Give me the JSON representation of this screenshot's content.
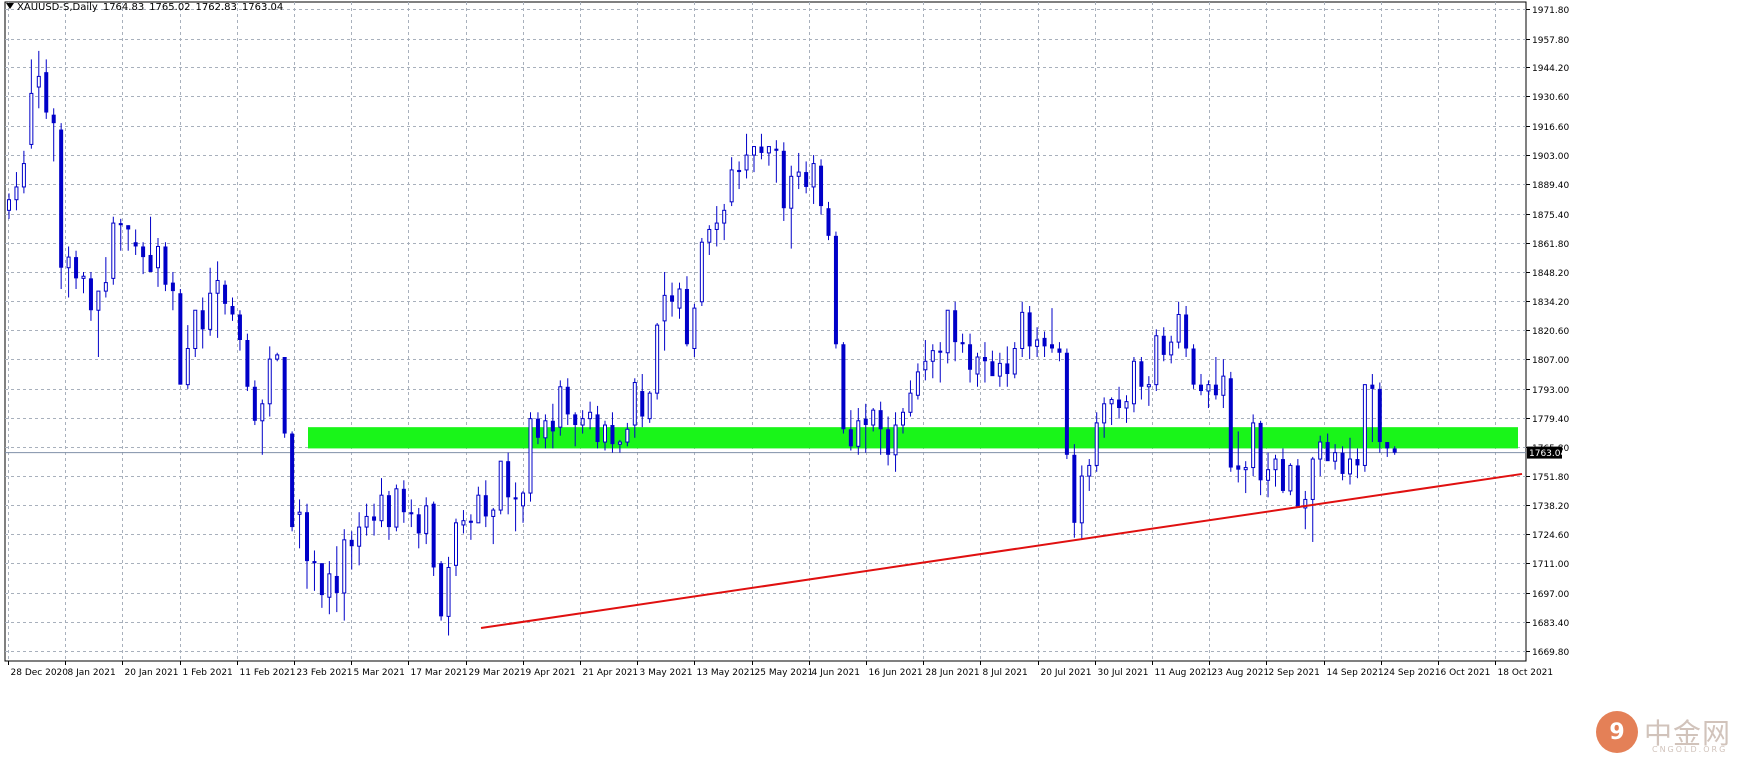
{
  "header": {
    "symbol": "XAUUSD-S,Daily",
    "open": "1764.83",
    "high": "1765.02",
    "low": "1762.83",
    "close": "1763.04"
  },
  "current_price_label": "1763.04",
  "watermark": {
    "badge": "9",
    "name": "中金网",
    "domain": "CNGOLD.ORG"
  },
  "colors": {
    "candle": "#0000c8",
    "grid": "#a8b0bc",
    "zone": "#19f519",
    "trendline": "#e01010",
    "price_line": "#8090a8",
    "axis": "#000000"
  },
  "chart_data": {
    "type": "candlestick",
    "title": "XAUUSD-S,Daily",
    "ylim": [
      1665,
      1975
    ],
    "y_ticks": [
      "1971.80",
      "1957.80",
      "1944.20",
      "1930.60",
      "1916.60",
      "1903.00",
      "1889.40",
      "1875.40",
      "1861.80",
      "1848.20",
      "1834.20",
      "1820.60",
      "1807.00",
      "1793.00",
      "1779.40",
      "1765.80",
      "1751.80",
      "1738.20",
      "1724.60",
      "1711.00",
      "1697.00",
      "1683.40",
      "1669.80"
    ],
    "x_ticks": [
      "28 Dec 2020",
      "8 Jan 2021",
      "20 Jan 2021",
      "1 Feb 2021",
      "11 Feb 2021",
      "23 Feb 2021",
      "5 Mar 2021",
      "17 Mar 2021",
      "29 Mar 2021",
      "9 Apr 2021",
      "21 Apr 2021",
      "3 May 2021",
      "13 May 2021",
      "25 May 2021",
      "4 Jun 2021",
      "16 Jun 2021",
      "28 Jun 2021",
      "8 Jul 2021",
      "20 Jul 2021",
      "30 Jul 2021",
      "11 Aug 2021",
      "23 Aug 2021",
      "2 Sep 2021",
      "14 Sep 2021",
      "24 Sep 2021",
      "6 Oct 2021",
      "18 Oct 2021"
    ],
    "x_start": "2020-12-28",
    "candles": [
      [
        1877,
        1885,
        1873,
        1882
      ],
      [
        1882,
        1895,
        1877,
        1888
      ],
      [
        1888,
        1905,
        1885,
        1899
      ],
      [
        1908,
        1948,
        1906,
        1932
      ],
      [
        1935,
        1952,
        1925,
        1940
      ],
      [
        1942,
        1948,
        1920,
        1923
      ],
      [
        1922,
        1925,
        1900,
        1918
      ],
      [
        1915,
        1918,
        1840,
        1850
      ],
      [
        1850,
        1860,
        1836,
        1855
      ],
      [
        1855,
        1858,
        1840,
        1845
      ],
      [
        1845,
        1848,
        1838,
        1846
      ],
      [
        1845,
        1848,
        1825,
        1830
      ],
      [
        1830,
        1839,
        1808,
        1839
      ],
      [
        1839,
        1855,
        1836,
        1843
      ],
      [
        1845,
        1874,
        1842,
        1871
      ],
      [
        1871,
        1873,
        1858,
        1870
      ],
      [
        1870,
        1870,
        1858,
        1868
      ],
      [
        1862,
        1868,
        1856,
        1860
      ],
      [
        1860,
        1862,
        1847,
        1855
      ],
      [
        1856,
        1874,
        1849,
        1848
      ],
      [
        1850,
        1864,
        1841,
        1860
      ],
      [
        1860,
        1862,
        1839,
        1842
      ],
      [
        1843,
        1848,
        1830,
        1839
      ],
      [
        1838,
        1840,
        1795,
        1795
      ],
      [
        1795,
        1823,
        1793,
        1812
      ],
      [
        1812,
        1830,
        1808,
        1830
      ],
      [
        1830,
        1836,
        1812,
        1821
      ],
      [
        1821,
        1850,
        1818,
        1838
      ],
      [
        1838,
        1853,
        1817,
        1844
      ],
      [
        1842,
        1844,
        1828,
        1833
      ],
      [
        1832,
        1836,
        1825,
        1828
      ],
      [
        1828,
        1830,
        1811,
        1816
      ],
      [
        1816,
        1819,
        1792,
        1794
      ],
      [
        1794,
        1797,
        1776,
        1778
      ],
      [
        1778,
        1788,
        1762,
        1786
      ],
      [
        1786,
        1813,
        1780,
        1807
      ],
      [
        1807,
        1810,
        1806,
        1809
      ],
      [
        1808,
        1808,
        1770,
        1772
      ],
      [
        1772,
        1773,
        1726,
        1728
      ],
      [
        1734,
        1741,
        1718,
        1735
      ],
      [
        1735,
        1739,
        1699,
        1712
      ],
      [
        1712,
        1717,
        1698,
        1711
      ],
      [
        1711,
        1711,
        1690,
        1696
      ],
      [
        1695,
        1712,
        1687,
        1706
      ],
      [
        1705,
        1719,
        1688,
        1697
      ],
      [
        1697,
        1727,
        1684,
        1722
      ],
      [
        1722,
        1726,
        1708,
        1719
      ],
      [
        1719,
        1735,
        1710,
        1728
      ],
      [
        1728,
        1739,
        1724,
        1733
      ],
      [
        1733,
        1739,
        1724,
        1731
      ],
      [
        1731,
        1751,
        1728,
        1743
      ],
      [
        1743,
        1745,
        1722,
        1728
      ],
      [
        1728,
        1748,
        1726,
        1746
      ],
      [
        1746,
        1750,
        1730,
        1735
      ],
      [
        1735,
        1741,
        1728,
        1734
      ],
      [
        1734,
        1737,
        1718,
        1725
      ],
      [
        1725,
        1742,
        1720,
        1738
      ],
      [
        1739,
        1740,
        1705,
        1709
      ],
      [
        1711,
        1712,
        1684,
        1686
      ],
      [
        1686,
        1714,
        1677,
        1709
      ],
      [
        1710,
        1732,
        1705,
        1730
      ],
      [
        1729,
        1736,
        1725,
        1731
      ],
      [
        1731,
        1734,
        1722,
        1730
      ],
      [
        1730,
        1747,
        1730,
        1743
      ],
      [
        1743,
        1750,
        1728,
        1733
      ],
      [
        1733,
        1737,
        1720,
        1736
      ],
      [
        1736,
        1759,
        1734,
        1759
      ],
      [
        1759,
        1763,
        1734,
        1742
      ],
      [
        1742,
        1749,
        1726,
        1741
      ],
      [
        1738,
        1745,
        1730,
        1744
      ],
      [
        1744,
        1782,
        1740,
        1779
      ],
      [
        1779,
        1782,
        1767,
        1770
      ],
      [
        1770,
        1781,
        1765,
        1778
      ],
      [
        1778,
        1786,
        1765,
        1773
      ],
      [
        1775,
        1797,
        1771,
        1794
      ],
      [
        1794,
        1798,
        1776,
        1781
      ],
      [
        1781,
        1782,
        1766,
        1776
      ],
      [
        1776,
        1783,
        1772,
        1779
      ],
      [
        1779,
        1787,
        1774,
        1782
      ],
      [
        1781,
        1785,
        1765,
        1768
      ],
      [
        1768,
        1778,
        1764,
        1776
      ],
      [
        1776,
        1782,
        1763,
        1767
      ],
      [
        1767,
        1769,
        1763,
        1768
      ],
      [
        1768,
        1777,
        1766,
        1774
      ],
      [
        1776,
        1798,
        1770,
        1796
      ],
      [
        1792,
        1800,
        1775,
        1780
      ],
      [
        1779,
        1792,
        1777,
        1791
      ],
      [
        1791,
        1824,
        1788,
        1823
      ],
      [
        1825,
        1848,
        1811,
        1837
      ],
      [
        1837,
        1843,
        1827,
        1834
      ],
      [
        1831,
        1843,
        1826,
        1840
      ],
      [
        1840,
        1846,
        1813,
        1814
      ],
      [
        1812,
        1833,
        1808,
        1831
      ],
      [
        1834,
        1864,
        1832,
        1862
      ],
      [
        1862,
        1870,
        1856,
        1868
      ],
      [
        1868,
        1879,
        1860,
        1871
      ],
      [
        1871,
        1880,
        1863,
        1877
      ],
      [
        1881,
        1902,
        1879,
        1896
      ],
      [
        1896,
        1900,
        1887,
        1895
      ],
      [
        1896,
        1913,
        1892,
        1903
      ],
      [
        1903,
        1906,
        1895,
        1907
      ],
      [
        1907,
        1913,
        1901,
        1904
      ],
      [
        1904,
        1906,
        1898,
        1907
      ],
      [
        1906,
        1910,
        1890,
        1905
      ],
      [
        1905,
        1909,
        1872,
        1878
      ],
      [
        1878,
        1898,
        1859,
        1893
      ],
      [
        1893,
        1904,
        1887,
        1895
      ],
      [
        1895,
        1900,
        1885,
        1888
      ],
      [
        1888,
        1903,
        1880,
        1899
      ],
      [
        1898,
        1901,
        1875,
        1879
      ],
      [
        1878,
        1881,
        1863,
        1865
      ],
      [
        1865,
        1867,
        1812,
        1814
      ],
      [
        1814,
        1815,
        1772,
        1774
      ],
      [
        1774,
        1783,
        1764,
        1766
      ],
      [
        1766,
        1784,
        1762,
        1778
      ],
      [
        1779,
        1786,
        1763,
        1776
      ],
      [
        1776,
        1784,
        1773,
        1783
      ],
      [
        1783,
        1787,
        1762,
        1774
      ],
      [
        1774,
        1780,
        1757,
        1762
      ],
      [
        1762,
        1782,
        1754,
        1776
      ],
      [
        1776,
        1784,
        1772,
        1782
      ],
      [
        1782,
        1797,
        1780,
        1791
      ],
      [
        1790,
        1805,
        1788,
        1801
      ],
      [
        1802,
        1816,
        1797,
        1806
      ],
      [
        1806,
        1814,
        1798,
        1811
      ],
      [
        1811,
        1815,
        1796,
        1810
      ],
      [
        1810,
        1830,
        1805,
        1830
      ],
      [
        1830,
        1834,
        1806,
        1815
      ],
      [
        1815,
        1819,
        1810,
        1814
      ],
      [
        1814,
        1819,
        1796,
        1802
      ],
      [
        1800,
        1810,
        1794,
        1808
      ],
      [
        1808,
        1815,
        1796,
        1806
      ],
      [
        1806,
        1811,
        1801,
        1799
      ],
      [
        1799,
        1810,
        1794,
        1805
      ],
      [
        1805,
        1813,
        1794,
        1800
      ],
      [
        1800,
        1815,
        1798,
        1812
      ],
      [
        1812,
        1834,
        1808,
        1829
      ],
      [
        1829,
        1832,
        1807,
        1813
      ],
      [
        1813,
        1822,
        1808,
        1816
      ],
      [
        1817,
        1820,
        1808,
        1813
      ],
      [
        1814,
        1831,
        1810,
        1812
      ],
      [
        1812,
        1815,
        1806,
        1810
      ],
      [
        1810,
        1812,
        1760,
        1762
      ],
      [
        1762,
        1767,
        1723,
        1730
      ],
      [
        1730,
        1757,
        1722,
        1752
      ],
      [
        1752,
        1760,
        1745,
        1757
      ],
      [
        1757,
        1782,
        1754,
        1777
      ],
      [
        1777,
        1789,
        1770,
        1786
      ],
      [
        1786,
        1789,
        1776,
        1788
      ],
      [
        1788,
        1794,
        1779,
        1784
      ],
      [
        1784,
        1790,
        1777,
        1787
      ],
      [
        1786,
        1808,
        1782,
        1806
      ],
      [
        1806,
        1808,
        1788,
        1794
      ],
      [
        1794,
        1799,
        1785,
        1795
      ],
      [
        1795,
        1821,
        1792,
        1818
      ],
      [
        1818,
        1822,
        1806,
        1809
      ],
      [
        1809,
        1818,
        1805,
        1815
      ],
      [
        1815,
        1834,
        1812,
        1828
      ],
      [
        1828,
        1832,
        1808,
        1812
      ],
      [
        1812,
        1814,
        1793,
        1795
      ],
      [
        1795,
        1800,
        1790,
        1792
      ],
      [
        1792,
        1797,
        1784,
        1795
      ],
      [
        1795,
        1808,
        1788,
        1790
      ],
      [
        1790,
        1807,
        1784,
        1799
      ],
      [
        1798,
        1801,
        1754,
        1756
      ],
      [
        1757,
        1773,
        1749,
        1755
      ],
      [
        1755,
        1759,
        1744,
        1756
      ],
      [
        1756,
        1781,
        1752,
        1777
      ],
      [
        1777,
        1778,
        1743,
        1750
      ],
      [
        1750,
        1763,
        1742,
        1755
      ],
      [
        1755,
        1762,
        1747,
        1760
      ],
      [
        1760,
        1765,
        1744,
        1745
      ],
      [
        1745,
        1758,
        1743,
        1757
      ],
      [
        1757,
        1760,
        1738,
        1737
      ],
      [
        1737,
        1745,
        1727,
        1741
      ],
      [
        1741,
        1761,
        1721,
        1760
      ],
      [
        1760,
        1771,
        1752,
        1768
      ],
      [
        1768,
        1772,
        1760,
        1759
      ],
      [
        1759,
        1767,
        1755,
        1763
      ],
      [
        1763,
        1766,
        1750,
        1753
      ],
      [
        1753,
        1770,
        1748,
        1760
      ],
      [
        1760,
        1765,
        1751,
        1757
      ],
      [
        1757,
        1793,
        1754,
        1795
      ],
      [
        1795,
        1800,
        1768,
        1793
      ],
      [
        1793,
        1796,
        1763,
        1768
      ],
      [
        1768,
        1768,
        1761,
        1765
      ],
      [
        1765,
        1766,
        1762,
        1763
      ]
    ],
    "zones": [
      {
        "low": 1765,
        "high": 1775
      }
    ],
    "trendline": {
      "from": [
        "29 Mar 2021",
        1680.5
      ],
      "to": [
        "18 Oct 2021+",
        1753
      ]
    },
    "current_price": 1763.04,
    "grid": true
  }
}
